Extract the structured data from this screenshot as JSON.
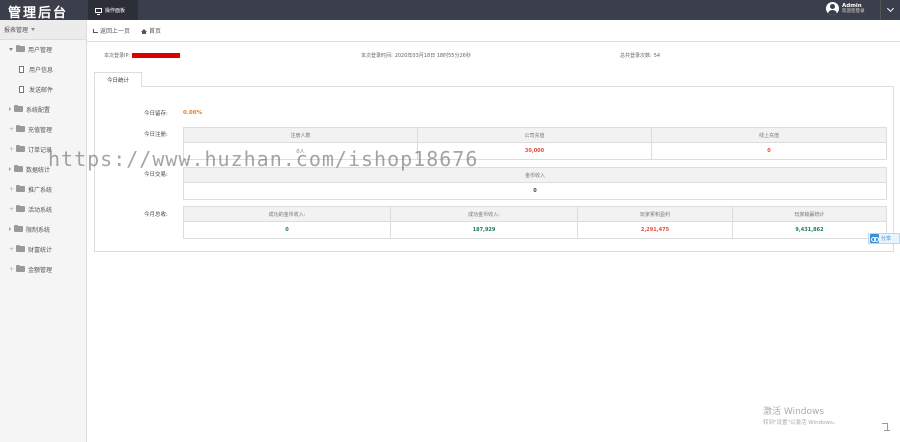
{
  "header": {
    "brand": "管理后台",
    "nav_tab": "操作面板",
    "user_name": "Admin",
    "user_subtitle": "欢迎您登录"
  },
  "sidebar": {
    "head": "报表管理",
    "items": [
      {
        "label": "用户管理"
      },
      {
        "label": "用户信息"
      },
      {
        "label": "发送邮件"
      },
      {
        "label": "系统配置"
      },
      {
        "label": "充值管理"
      },
      {
        "label": "订单记录"
      },
      {
        "label": "数据统计"
      },
      {
        "label": "推广系统"
      },
      {
        "label": "活动系统"
      },
      {
        "label": "限制系统"
      },
      {
        "label": "财富统计"
      },
      {
        "label": "金额管理"
      }
    ]
  },
  "breadcrumb": {
    "back": "返回上一页",
    "home": "首页"
  },
  "info": {
    "login_ip_label": "本次登录IP:",
    "login_time_label": "本次登录时间:",
    "login_time_value": "2020年03月18日 18时55分26秒",
    "login_count_label": "总共登录次数:",
    "login_count_value": "54"
  },
  "tab": {
    "label": "今日统计"
  },
  "stats": {
    "rate_label": "今日留存:",
    "rate_value": "0.00%",
    "register_label": "今日注册:",
    "register_headers": [
      "注册人数",
      "公司充值",
      "线上充值"
    ],
    "register_values": [
      "0人",
      "30,000",
      "0"
    ],
    "trade_label": "今日交易:",
    "trade_header": "金币收入",
    "trade_value": "0",
    "month_label": "今月总收:",
    "month_headers": [
      "成功的金币收入:",
      "成功金币收入:",
      "玩家累积盈利",
      "玩家输赢统计"
    ],
    "month_values": [
      "0",
      "187,929",
      "2,291,475",
      "9,431,862"
    ]
  },
  "overlay": {
    "watermark": "https://www.huzhan.com/ishop18676",
    "share_label": "分享"
  },
  "activation": {
    "title": "激活 Windows",
    "subtitle": "转到\"设置\"以激活 Windows。"
  }
}
